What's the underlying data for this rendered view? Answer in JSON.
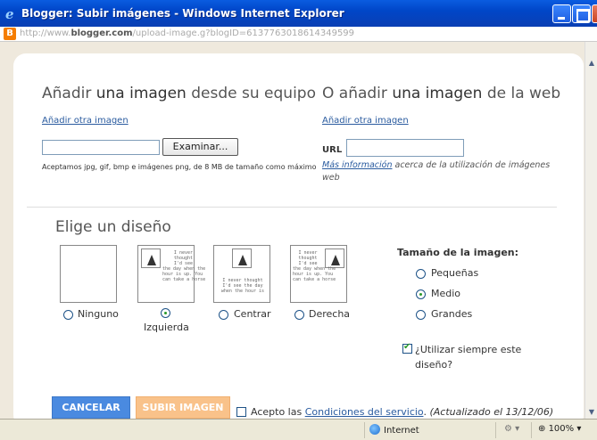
{
  "window": {
    "title": "Blogger: Subir imágenes - Windows Internet Explorer",
    "url_prefix": "http://www.",
    "url_domain": "blogger.com",
    "url_path": "/upload-image.g?blogID=6137763018614349599"
  },
  "local": {
    "heading_pre": "Añadir ",
    "heading_bold": "una imagen",
    "heading_post": " desde su equipo",
    "add_another": "Añadir otra imagen",
    "browse_label": "Examinar...",
    "accepted_note": "Aceptamos jpg, gif, bmp e imágenes png, de 8 MB de tamaño como máximo"
  },
  "web": {
    "heading_pre": "O añadir ",
    "heading_bold": "una imagen",
    "heading_post": " de la web",
    "add_another": "Añadir otra imagen",
    "url_label": "URL",
    "more_info": "Más información",
    "more_info_rest": " acerca de la utilización de imágenes web"
  },
  "layout": {
    "heading": "Elige un diseño",
    "thumb_text": "I never\nthought\nI'd see\nthe day when the\nhour is up. You\ncan take a horse",
    "thumb_text_center": "I never thought\nI'd see the day\nwhen the hour is",
    "options": [
      {
        "label": "Ninguno",
        "selected": false
      },
      {
        "label": "Izquierda",
        "selected": true
      },
      {
        "label": "Centrar",
        "selected": false
      },
      {
        "label": "Derecha",
        "selected": false
      }
    ]
  },
  "size": {
    "heading": "Tamaño de la imagen:",
    "options": [
      {
        "label": "Pequeñas",
        "selected": false
      },
      {
        "label": "Medio",
        "selected": true
      },
      {
        "label": "Grandes",
        "selected": false
      }
    ],
    "always_use_label": "¿Utilizar siempre este diseño?",
    "always_use_checked": true
  },
  "actions": {
    "cancel_label": "CANCELAR",
    "upload_label": "SUBIR IMAGEN",
    "accept_pre": "Acepto las ",
    "terms_link": "Condiciones del servicio",
    "updated_note": "(Actualizado el 13/12/06)"
  },
  "status": {
    "zone": "Internet",
    "zoom": "100%"
  },
  "colors": {
    "accent_link": "#2a5b9f",
    "cancel_bg": "#4a8ae0",
    "upload_bg": "#f9c28a",
    "titlebar": "#0046c8"
  }
}
